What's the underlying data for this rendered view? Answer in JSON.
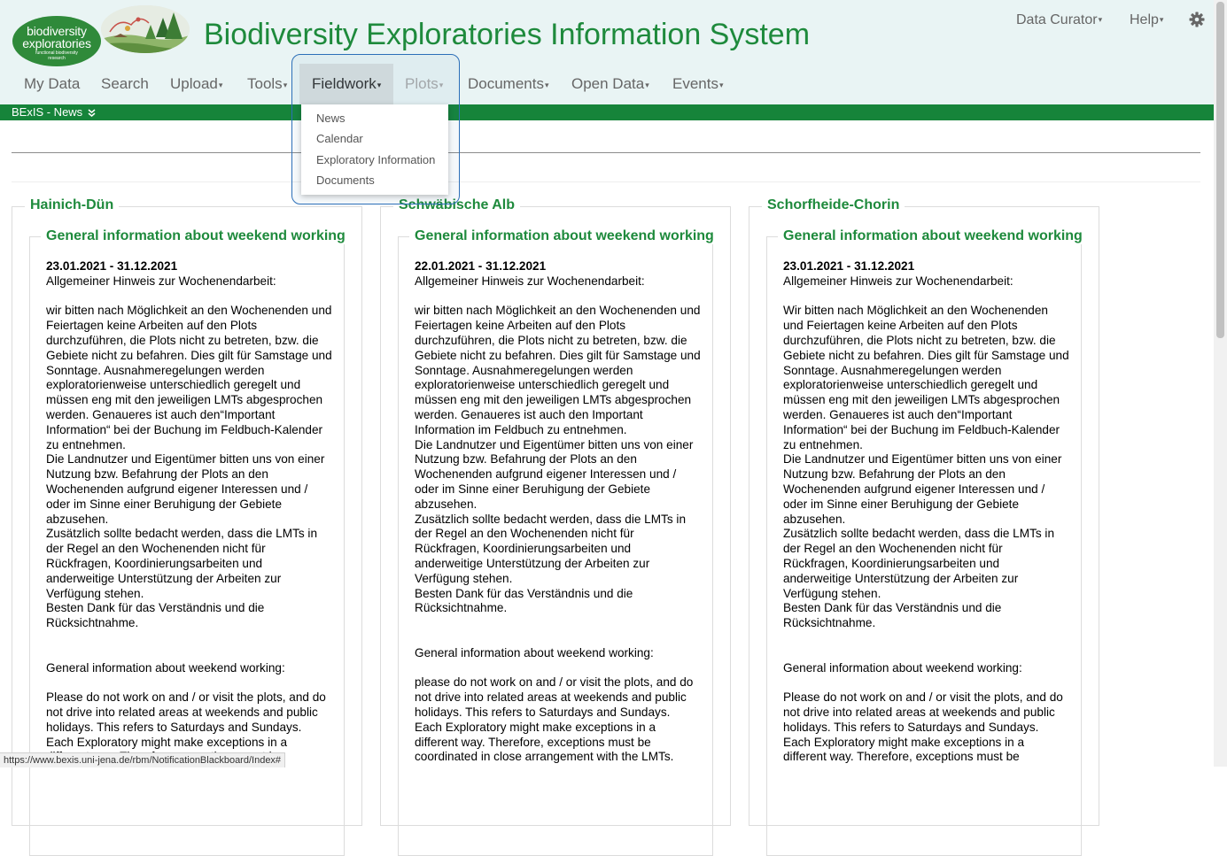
{
  "header": {
    "logo": {
      "line1": "biodiversity",
      "line2": "exploratories",
      "line3": "functional biodiversity",
      "line4": "research"
    },
    "title": "Biodiversity Exploratories Information System",
    "user_menu": "Data Curator",
    "help_menu": "Help",
    "settings_icon": "gear-icon"
  },
  "nav": {
    "items": [
      {
        "label": "My Data"
      },
      {
        "label": "Search"
      },
      {
        "label": "Upload"
      },
      {
        "label": "Tools"
      },
      {
        "label": "Fieldwork"
      },
      {
        "label": "Plots"
      },
      {
        "label": "Documents"
      },
      {
        "label": "Open Data"
      },
      {
        "label": "Events"
      }
    ],
    "active": "Fieldwork"
  },
  "dropdown": {
    "items": [
      "News",
      "Calendar",
      "Exploratory Information",
      "Documents"
    ]
  },
  "newsbar": {
    "label": "BExIS - News",
    "icon": "double-chevron-down-icon"
  },
  "regions": [
    {
      "name": "Hainich-Dün",
      "notice_title": "General information about weekend working",
      "date": "23.01.2021 - 31.12.2021",
      "de_heading": "Allgemeiner Hinweis zur Wochenendarbeit:",
      "de_p1_lines": [
        "wir bitten nach Möglichkeit an den Wochenenden und",
        "Feiertagen keine Arbeiten auf den Plots",
        "durchzuführen, die Plots nicht zu betreten, bzw. die",
        "Gebiete nicht zu befahren. Dies gilt für Samstage und",
        "Sonntage. Ausnahmeregelungen werden",
        "exploratorienweise unterschiedlich geregelt und",
        "müssen eng mit den jeweiligen LMTs abgesprochen",
        "werden. Genaueres ist auch den“Important",
        "Information“ bei der Buchung im Feldbuch-Kalender",
        "zu entnehmen."
      ],
      "de_p2_lines": [
        "Die Landnutzer und Eigentümer bitten uns von einer",
        "Nutzung bzw. Befahrung der Plots an den",
        "Wochenenden aufgrund eigener Interessen und /",
        "oder im Sinne einer Beruhigung der Gebiete",
        "abzusehen."
      ],
      "de_p3_lines": [
        "Zusätzlich sollte bedacht werden, dass die LMTs in",
        "der Regel an den Wochenenden nicht für",
        "Rückfragen, Koordinierungsarbeiten und",
        "anderweitige Unterstützung der Arbeiten zur",
        "Verfügung stehen."
      ],
      "de_p4_lines": [
        "Besten Dank für das Verständnis und die",
        "Rücksichtnahme."
      ],
      "en_heading": "General information about weekend working:",
      "en_p1_lines": [
        "Please do not work on and / or visit the plots, and do",
        "not drive into related areas at weekends and public",
        "holidays. This refers to Saturdays and Sundays.",
        "Each Exploratory might make exceptions in a",
        "different way. Therefore, exceptions must be"
      ],
      "en_gap_before": 2
    },
    {
      "name": "Schwäbische Alb",
      "notice_title": "General information about weekend working",
      "date": "22.01.2021 - 31.12.2021",
      "de_heading": "Allgemeiner Hinweis zur Wochenendarbeit:",
      "de_p1_lines": [
        "wir bitten nach Möglichkeit an den Wochenenden und",
        "Feiertagen keine Arbeiten auf den Plots",
        "durchzuführen, die Plots nicht zu betreten, bzw. die",
        "Gebiete nicht zu befahren. Dies gilt für Samstage und",
        "Sonntage. Ausnahmeregelungen werden",
        "exploratorienweise unterschiedlich geregelt und",
        "müssen eng mit den jeweiligen LMTs abgesprochen",
        "werden. Genaueres ist auch den Important",
        "Information im Feldbuch zu entnehmen."
      ],
      "de_p2_lines": [
        "Die Landnutzer und Eigentümer bitten uns von einer",
        "Nutzung bzw. Befahrung der Plots an den",
        "Wochenenden aufgrund eigener Interessen und /",
        "oder im Sinne einer Beruhigung der Gebiete",
        "abzusehen."
      ],
      "de_p3_lines": [
        "Zusätzlich sollte bedacht werden, dass die LMTs in",
        "der Regel an den Wochenenden nicht für",
        "Rückfragen, Koordinierungsarbeiten und",
        "anderweitige Unterstützung der Arbeiten zur",
        "Verfügung stehen."
      ],
      "de_p4_lines": [
        "Besten Dank für das Verständnis und die",
        "Rücksichtnahme."
      ],
      "en_heading": "General information about weekend working:",
      "en_p1_lines": [
        "please do not work on and / or visit the plots, and do",
        "not drive into related areas at weekends and public",
        "holidays. This refers to Saturdays and Sundays.",
        "Each Exploratory might make exceptions in a",
        "different way. Therefore, exceptions must be",
        "coordinated in close arrangement with the LMTs."
      ],
      "en_gap_before": 2
    },
    {
      "name": "Schorfheide-Chorin",
      "notice_title": "General information about weekend working",
      "date": "23.01.2021 - 31.12.2021",
      "de_heading": "Allgemeiner Hinweis zur Wochenendarbeit:",
      "de_p1_lines": [
        "Wir bitten nach Möglichkeit an den Wochenenden",
        "und Feiertagen keine Arbeiten auf den Plots",
        "durchzuführen, die Plots nicht zu betreten, bzw. die",
        "Gebiete nicht zu befahren. Dies gilt für Samstage und",
        "Sonntage. Ausnahmeregelungen werden",
        "exploratorienweise unterschiedlich geregelt und",
        "müssen eng mit den jeweiligen LMTs abgesprochen",
        "werden. Genaueres ist auch den“Important",
        "Information“ bei der Buchung im Feldbuch-Kalender",
        "zu entnehmen."
      ],
      "de_p2_lines": [
        "Die Landnutzer und Eigentümer bitten uns von einer",
        "Nutzung bzw. Befahrung der Plots an den",
        "Wochenenden aufgrund eigener Interessen und /",
        "oder im Sinne einer Beruhigung der Gebiete",
        "abzusehen."
      ],
      "de_p3_lines": [
        "Zusätzlich sollte bedacht werden, dass die LMTs in",
        "der Regel an den Wochenenden nicht für",
        "Rückfragen, Koordinierungsarbeiten und",
        "anderweitige Unterstützung der Arbeiten zur",
        "Verfügung stehen."
      ],
      "de_p4_lines": [
        "Besten Dank für das Verständnis und die",
        "Rücksichtnahme."
      ],
      "en_heading": "General information about weekend working:",
      "en_p1_lines": [
        "Please do not work on and / or visit the plots, and do",
        "not drive into related areas at weekends and public",
        "holidays. This refers to Saturdays and Sundays.",
        "Each Exploratory might make exceptions in a",
        "different way. Therefore, exceptions must be"
      ],
      "en_gap_before": 2
    }
  ],
  "statusbar": {
    "url": "https://www.bexis.uni-jena.de/rbm/NotificationBlackboard/Index#"
  },
  "colors": {
    "brand_green": "#1e8a3c",
    "newsbar_green": "#16843a",
    "highlight_blue": "#2c6fb8",
    "header_bg": "#e9f4f4"
  }
}
